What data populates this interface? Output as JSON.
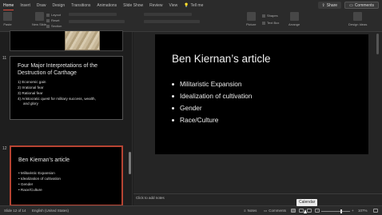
{
  "ribbon": {
    "tabs": [
      "Home",
      "Insert",
      "Draw",
      "Design",
      "Transitions",
      "Animations",
      "Slide Show",
      "Review",
      "View"
    ],
    "tell_me": "Tell me",
    "share_label": "Share",
    "comments_label": "Comments",
    "paste_label": "Paste",
    "new_slide_label": "New Slide",
    "layout_label": "Layout",
    "reset_label": "Reset",
    "section_label": "Section",
    "picture_label": "Picture",
    "shapes_label": "Shapes",
    "text_box_label": "Text Box",
    "arrange_label": "Arrange",
    "design_ideas_label": "Design Ideas"
  },
  "slides": [
    {
      "number": "11",
      "title": "Four Major Interpretations of the Destruction of Carthage",
      "items": [
        "1)  Economic gain",
        "2)  Irrational fear",
        "3)  Rational fear",
        "4)  Aristocratic quest for military success, wealth,",
        "and glory"
      ]
    },
    {
      "number": "12",
      "title": "Ben Kiernan’s article",
      "items": [
        "Militaristic Expansion",
        "Idealization of cultivation",
        "Gender",
        "Race/Culture"
      ]
    }
  ],
  "current_slide": {
    "title": "Ben Kiernan’s article",
    "bullets": [
      "Militaristic Expansion",
      "Idealization of cultivation",
      "Gender",
      "Race/Culture"
    ]
  },
  "notes_placeholder": "Click to add notes",
  "status": {
    "slide_counter": "Slide 12 of 14",
    "language": "English (United States)",
    "notes_label": "Notes",
    "comments_label": "Comments",
    "zoom": "107%",
    "tooltip": "Calendar"
  },
  "colors": {
    "selection_border": "#b74433",
    "accent": "#e04a3a"
  }
}
